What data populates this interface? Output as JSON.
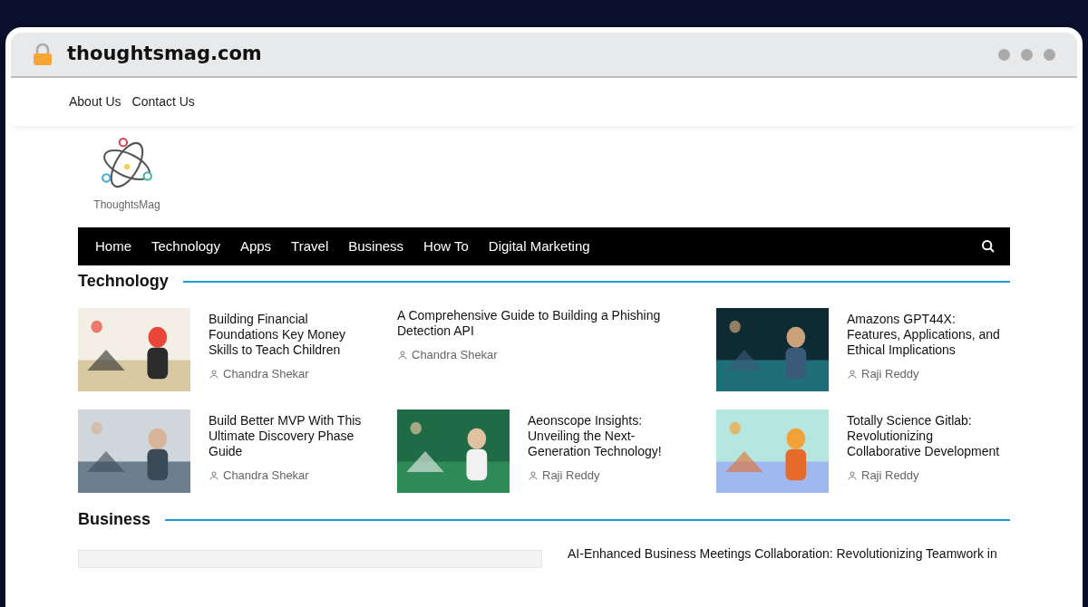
{
  "browser": {
    "url": "thoughtsmag.com"
  },
  "top_links": [
    "About Us",
    "Contact Us"
  ],
  "logo": {
    "name": "ThoughtsMag"
  },
  "nav": [
    "Home",
    "Technology",
    "Apps",
    "Travel",
    "Business",
    "How To",
    "Digital Marketing"
  ],
  "sections": [
    {
      "title": "Technology",
      "articles": [
        {
          "title": "Building Financial Foundations Key Money Skills to Teach Children",
          "author": "Chandra Shekar",
          "kind": "picture"
        },
        {
          "title": "A Comprehensive Guide to Building a Phishing Detection API",
          "author": "Chandra Shekar",
          "kind": "text"
        },
        {
          "title": "Amazons GPT44X: Features, Applications, and Ethical Implications",
          "author": "Raji Reddy",
          "kind": "picture"
        },
        {
          "title": "Build Better MVP With This Ultimate Discovery Phase Guide",
          "author": "Chandra Shekar",
          "kind": "picture"
        },
        {
          "title": "Aeonscope Insights: Unveiling the Next-Generation Technology!",
          "author": "Raji Reddy",
          "kind": "picture"
        },
        {
          "title": "Totally Science Gitlab: Revolutionizing Collaborative Development",
          "author": "Raji Reddy",
          "kind": "picture"
        }
      ]
    },
    {
      "title": "Business",
      "articles": [
        {
          "title": "AI-Enhanced Business Meetings Collaboration: Revolutionizing Teamwork in",
          "kind": "wide"
        }
      ]
    }
  ]
}
